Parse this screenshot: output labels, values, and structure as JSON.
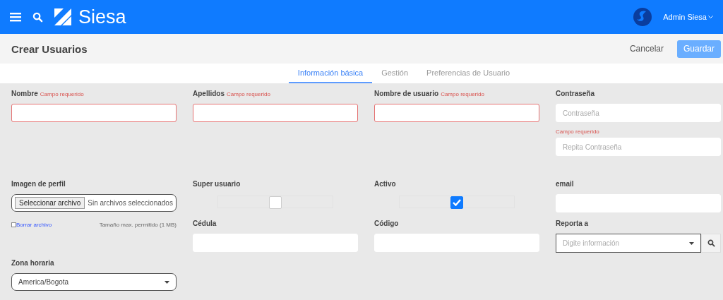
{
  "header": {
    "brand": "Siesa",
    "user": "Admin Siesa"
  },
  "page": {
    "title": "Crear Usuarios",
    "buttons": [
      {
        "label": "Cancelar",
        "kind": "link"
      },
      {
        "label": "Guardar",
        "kind": "primary",
        "disabled": true
      }
    ]
  },
  "tabs": [
    {
      "label": "Información básica",
      "selected": true
    },
    {
      "label": "Gestión",
      "selected": false
    },
    {
      "label": "Preferencias de Usuario",
      "selected": false
    }
  ],
  "fields": [
    {
      "kind": "text",
      "label": "Nombre",
      "note": "Campo requerido",
      "error": true
    },
    {
      "kind": "text",
      "label": "Apellidos",
      "note": "Campo requerido",
      "error": true
    },
    {
      "kind": "text",
      "label": "Nombre de usuario",
      "note": "Campo requerido",
      "error": true
    },
    {
      "kind": "password",
      "label": "Contraseña",
      "placeholder": "Contraseña",
      "note": "Campo requerido",
      "placeholder2": "Repita Contraseña"
    },
    {
      "kind": "file",
      "label": "Imagen de perfil",
      "button": "Seleccionar archivo",
      "status": "Sin archivos seleccionados",
      "delete_label": "Borrar archivo",
      "delete_checked": false,
      "hint": "Tamaño max. permitido (1 MB)"
    },
    {
      "kind": "checkbox",
      "label": "Super usuario",
      "checked": false
    },
    {
      "kind": "checkbox",
      "label": "Activo",
      "checked": true
    },
    {
      "kind": "text",
      "label": "email",
      "error": false
    },
    {
      "kind": "text",
      "label": "Cédula",
      "error": false
    },
    {
      "kind": "text",
      "label": "Código",
      "error": false
    },
    {
      "kind": "lookup",
      "label": "Reporta a",
      "placeholder": "Digite información"
    },
    {
      "kind": "select",
      "label": "Zona horaria",
      "value": "America/Bogota"
    }
  ]
}
